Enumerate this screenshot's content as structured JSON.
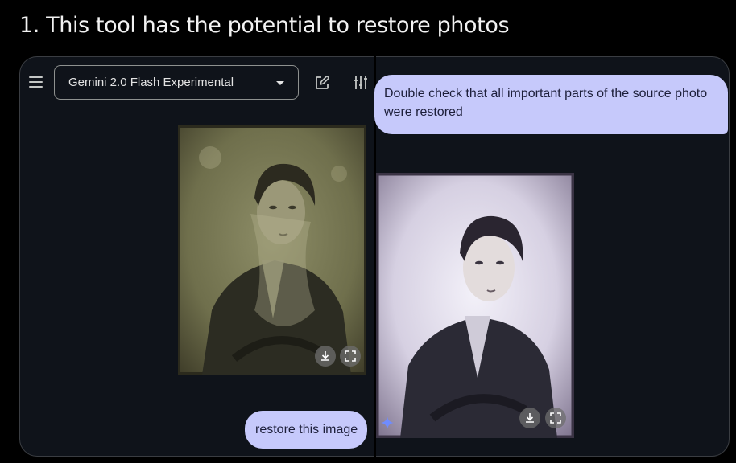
{
  "heading": "1. This tool has the potential to restore photos",
  "toolbar": {
    "model_name": "Gemini 2.0 Flash Experimental",
    "menu_icon": "menu-icon",
    "dropdown_icon": "dropdown-caret-icon",
    "new_chat_icon": "edit-icon",
    "settings_icon": "tune-icon"
  },
  "chat": {
    "user_message": "restore this image",
    "prompt_message": "Double check that all important parts of the source photo were restored"
  },
  "original_photo": {
    "actions": [
      "download-icon",
      "fullscreen-icon"
    ]
  },
  "restored_photo": {
    "actions": [
      "download-icon",
      "fullscreen-icon"
    ],
    "badge": "gemini-sparkle-icon"
  },
  "colors": {
    "user_bubble": "#c6c9fb",
    "panel": "#0f131a",
    "page": "#000000"
  }
}
